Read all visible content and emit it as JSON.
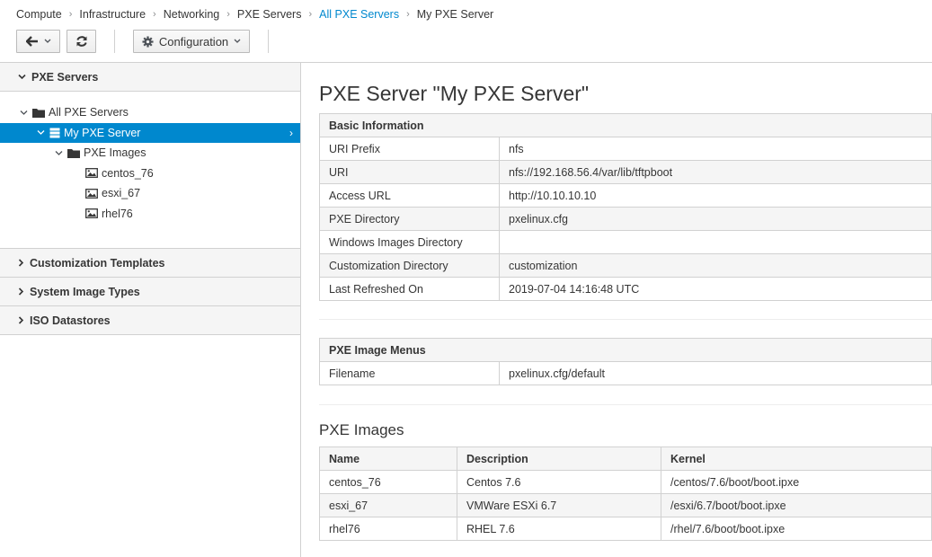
{
  "breadcrumb": {
    "items": [
      "Compute",
      "Infrastructure",
      "Networking",
      "PXE Servers",
      "All PXE Servers",
      "My PXE Server"
    ]
  },
  "toolbar": {
    "configuration_label": "Configuration",
    "icons": [
      "back-arrow-icon",
      "refresh-icon",
      "gear-icon"
    ]
  },
  "sidebar": {
    "accordion_open": "PXE Servers",
    "tree": {
      "root": "All PXE Servers",
      "server": "My PXE Server",
      "folder": "PXE Images",
      "images": [
        "centos_76",
        "esxi_67",
        "rhel76"
      ]
    },
    "accordion_closed": [
      "Customization Templates",
      "System Image Types",
      "ISO Datastores"
    ]
  },
  "main": {
    "title": "PXE Server \"My PXE Server\"",
    "basic_info": {
      "header": "Basic Information",
      "rows": [
        {
          "label": "URI Prefix",
          "value": "nfs"
        },
        {
          "label": "URI",
          "value": "nfs://192.168.56.4/var/lib/tftpboot"
        },
        {
          "label": "Access URL",
          "value": "http://10.10.10.10"
        },
        {
          "label": "PXE Directory",
          "value": "pxelinux.cfg"
        },
        {
          "label": "Windows Images Directory",
          "value": ""
        },
        {
          "label": "Customization Directory",
          "value": "customization"
        },
        {
          "label": "Last Refreshed On",
          "value": "2019-07-04 14:16:48 UTC"
        }
      ]
    },
    "image_menus": {
      "header": "PXE Image Menus",
      "rows": [
        {
          "label": "Filename",
          "value": "pxelinux.cfg/default"
        }
      ]
    },
    "images": {
      "title": "PXE Images",
      "columns": [
        "Name",
        "Description",
        "Kernel"
      ],
      "rows": [
        [
          "centos_76",
          "Centos 7.6",
          "/centos/7.6/boot/boot.ipxe"
        ],
        [
          "esxi_67",
          "VMWare ESXi 6.7",
          "/esxi/6.7/boot/boot.ipxe"
        ],
        [
          "rhel76",
          "RHEL 7.6",
          "/rhel/7.6/boot/boot.ipxe"
        ]
      ]
    }
  }
}
